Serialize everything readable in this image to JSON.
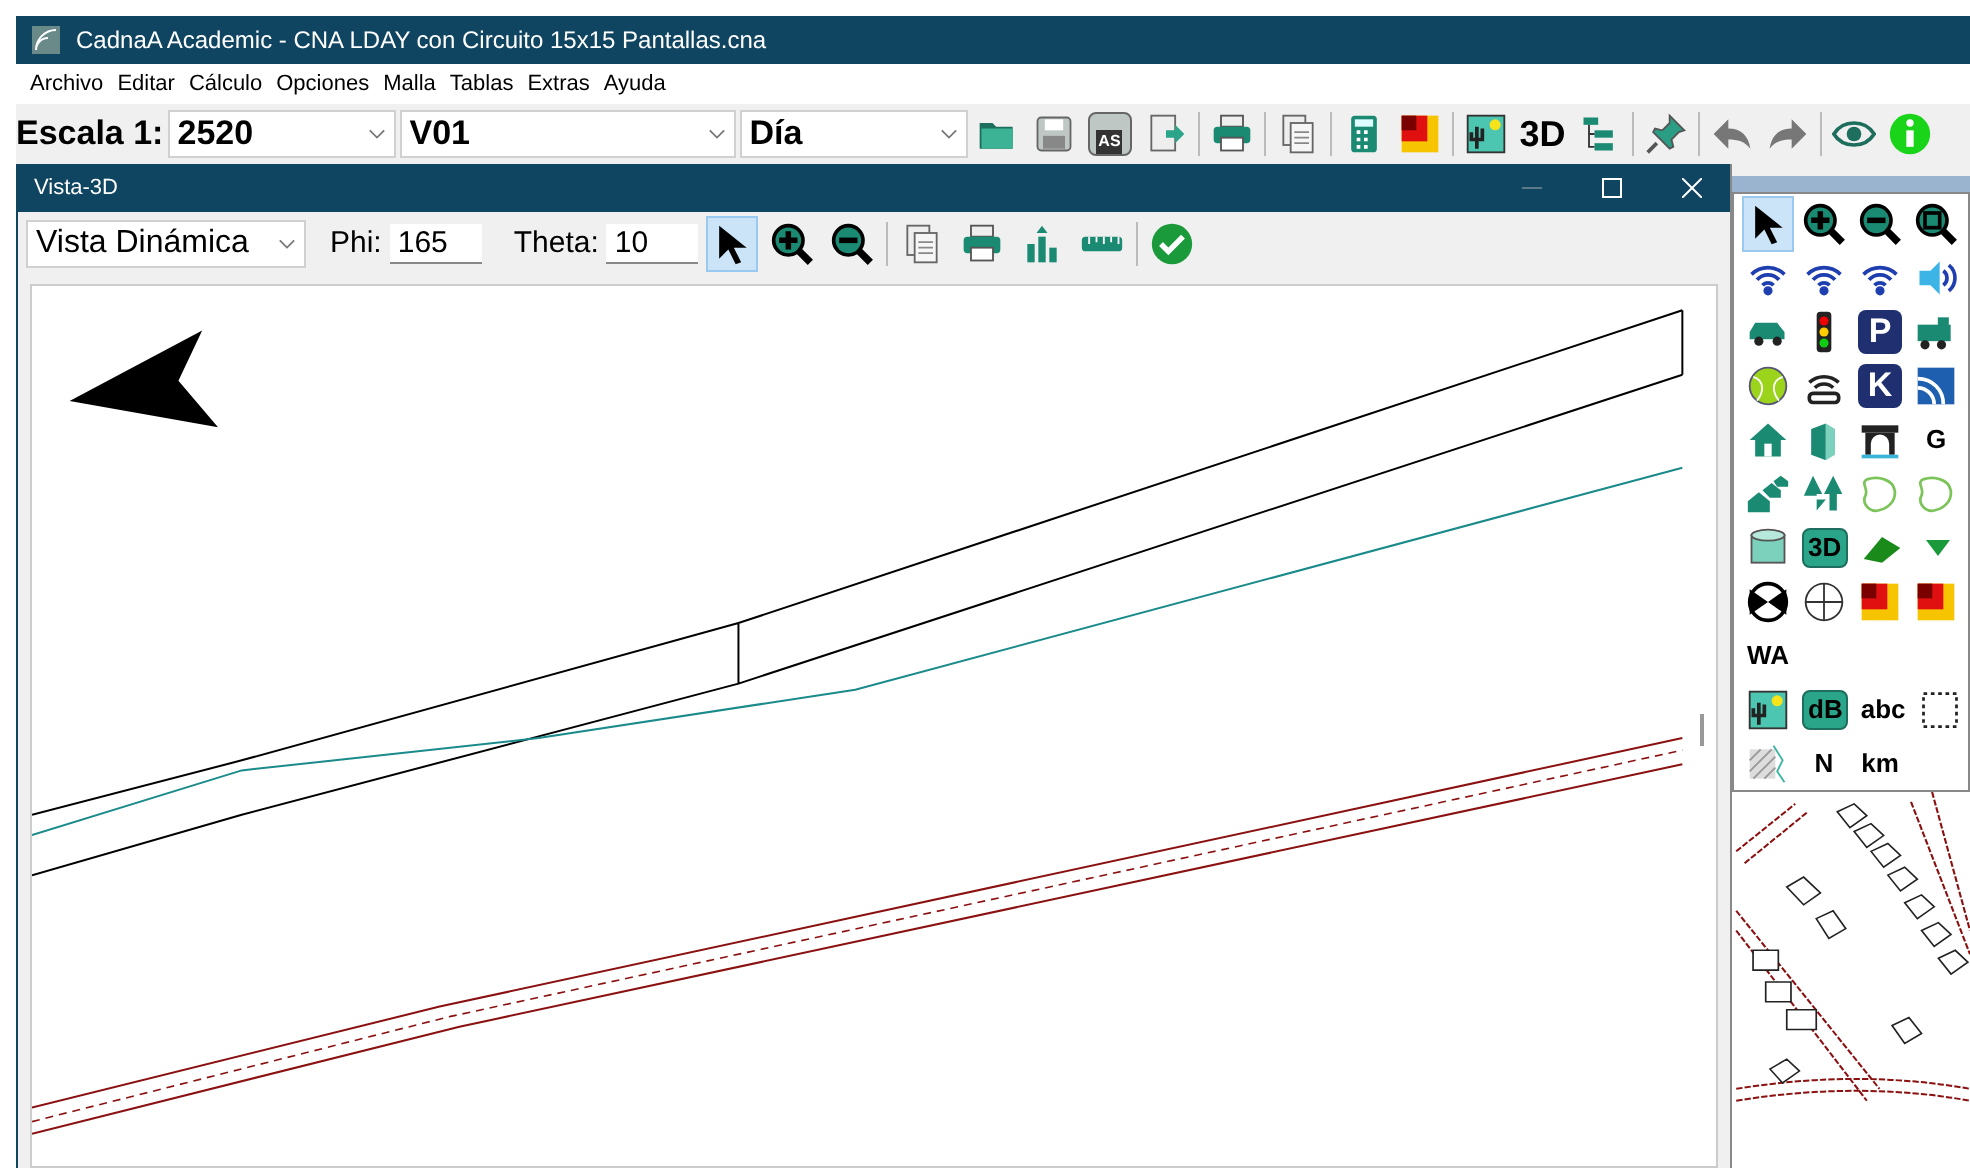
{
  "window": {
    "title": "CadnaA Academic - CNA LDAY con Circuito 15x15 Pantallas.cna"
  },
  "menu": [
    "Archivo",
    "Editar",
    "Cálculo",
    "Opciones",
    "Malla",
    "Tablas",
    "Extras",
    "Ayuda"
  ],
  "toolbar": {
    "scale_label": "Escala 1:",
    "scale": "2520",
    "variant": "V01",
    "period": "Día",
    "buttons": [
      {
        "kind": "folder"
      },
      {
        "kind": "save"
      },
      {
        "kind": "save-as",
        "label": "AS"
      },
      {
        "kind": "export"
      },
      {
        "kind": "sep"
      },
      {
        "kind": "printer"
      },
      {
        "kind": "sep"
      },
      {
        "kind": "documents"
      },
      {
        "kind": "sep"
      },
      {
        "kind": "calculator"
      },
      {
        "kind": "color-grid"
      },
      {
        "kind": "sep"
      },
      {
        "kind": "landscape"
      },
      {
        "kind": "text",
        "label": "3D"
      },
      {
        "kind": "tree"
      },
      {
        "kind": "sep"
      },
      {
        "kind": "pin"
      },
      {
        "kind": "sep"
      },
      {
        "kind": "undo"
      },
      {
        "kind": "redo"
      },
      {
        "kind": "sep"
      },
      {
        "kind": "eye"
      },
      {
        "kind": "info"
      }
    ]
  },
  "view_window": {
    "title": "Vista-3D",
    "mode": "Vista Dinámica",
    "phi_label": "Phi:",
    "phi": "165",
    "theta_label": "Theta:",
    "theta": "10",
    "tools": [
      {
        "kind": "pointer",
        "selected": true
      },
      {
        "kind": "zoom-in",
        "selected": false
      },
      {
        "kind": "zoom-out",
        "selected": false
      }
    ],
    "actions": [
      {
        "kind": "sep"
      },
      {
        "kind": "documents"
      },
      {
        "kind": "printer"
      },
      {
        "kind": "bar-chart"
      },
      {
        "kind": "ruler"
      },
      {
        "kind": "sep"
      },
      {
        "kind": "check"
      }
    ]
  },
  "toolbox": [
    [
      {
        "kind": "pointer",
        "selected": true
      },
      {
        "kind": "zoom-in",
        "selected": false
      },
      {
        "kind": "zoom-out",
        "selected": false
      },
      {
        "kind": "zoom-fit",
        "selected": false
      }
    ],
    [
      {
        "kind": "signal",
        "selected": false
      },
      {
        "kind": "signal",
        "selected": false
      },
      {
        "kind": "signal",
        "selected": false
      },
      {
        "kind": "speaker",
        "selected": false
      }
    ],
    [
      {
        "kind": "car",
        "selected": false
      },
      {
        "kind": "traffic-light",
        "selected": false
      },
      {
        "kind": "letter",
        "label": "P",
        "selected": false
      },
      {
        "kind": "train",
        "selected": false
      }
    ],
    [
      {
        "kind": "ball",
        "selected": false
      },
      {
        "kind": "antenna",
        "selected": false
      },
      {
        "kind": "letter",
        "label": "K",
        "selected": false
      },
      {
        "kind": "waves",
        "selected": false
      }
    ],
    [
      {
        "kind": "house",
        "selected": false
      },
      {
        "kind": "wall",
        "selected": false
      },
      {
        "kind": "bridge",
        "selected": false
      },
      {
        "kind": "text",
        "label": "G",
        "selected": false
      }
    ],
    [
      {
        "kind": "houses",
        "selected": false
      },
      {
        "kind": "trees",
        "selected": false
      },
      {
        "kind": "contour",
        "selected": false
      },
      {
        "kind": "contour",
        "selected": false
      }
    ],
    [
      {
        "kind": "cylinder",
        "selected": false
      },
      {
        "kind": "tag",
        "label": "3D",
        "selected": false
      },
      {
        "kind": "slope",
        "selected": false
      },
      {
        "kind": "triangle",
        "selected": false
      }
    ],
    [
      {
        "kind": "bowtie",
        "selected": false
      },
      {
        "kind": "circle-grid",
        "selected": false
      },
      {
        "kind": "color-grid",
        "selected": false
      },
      {
        "kind": "color-grid",
        "selected": false
      }
    ],
    [
      {
        "kind": "text",
        "label": "WA",
        "selected": false
      }
    ],
    [
      {
        "kind": "landscape",
        "selected": false
      },
      {
        "kind": "tag",
        "label": "dB",
        "selected": false
      },
      {
        "kind": "text",
        "label": "abc",
        "selected": false
      },
      {
        "kind": "dotted-rect",
        "selected": false
      }
    ],
    [
      {
        "kind": "hatch",
        "selected": false
      },
      {
        "kind": "text",
        "label": "N",
        "selected": false
      },
      {
        "kind": "text",
        "label": "km",
        "selected": false
      }
    ]
  ]
}
